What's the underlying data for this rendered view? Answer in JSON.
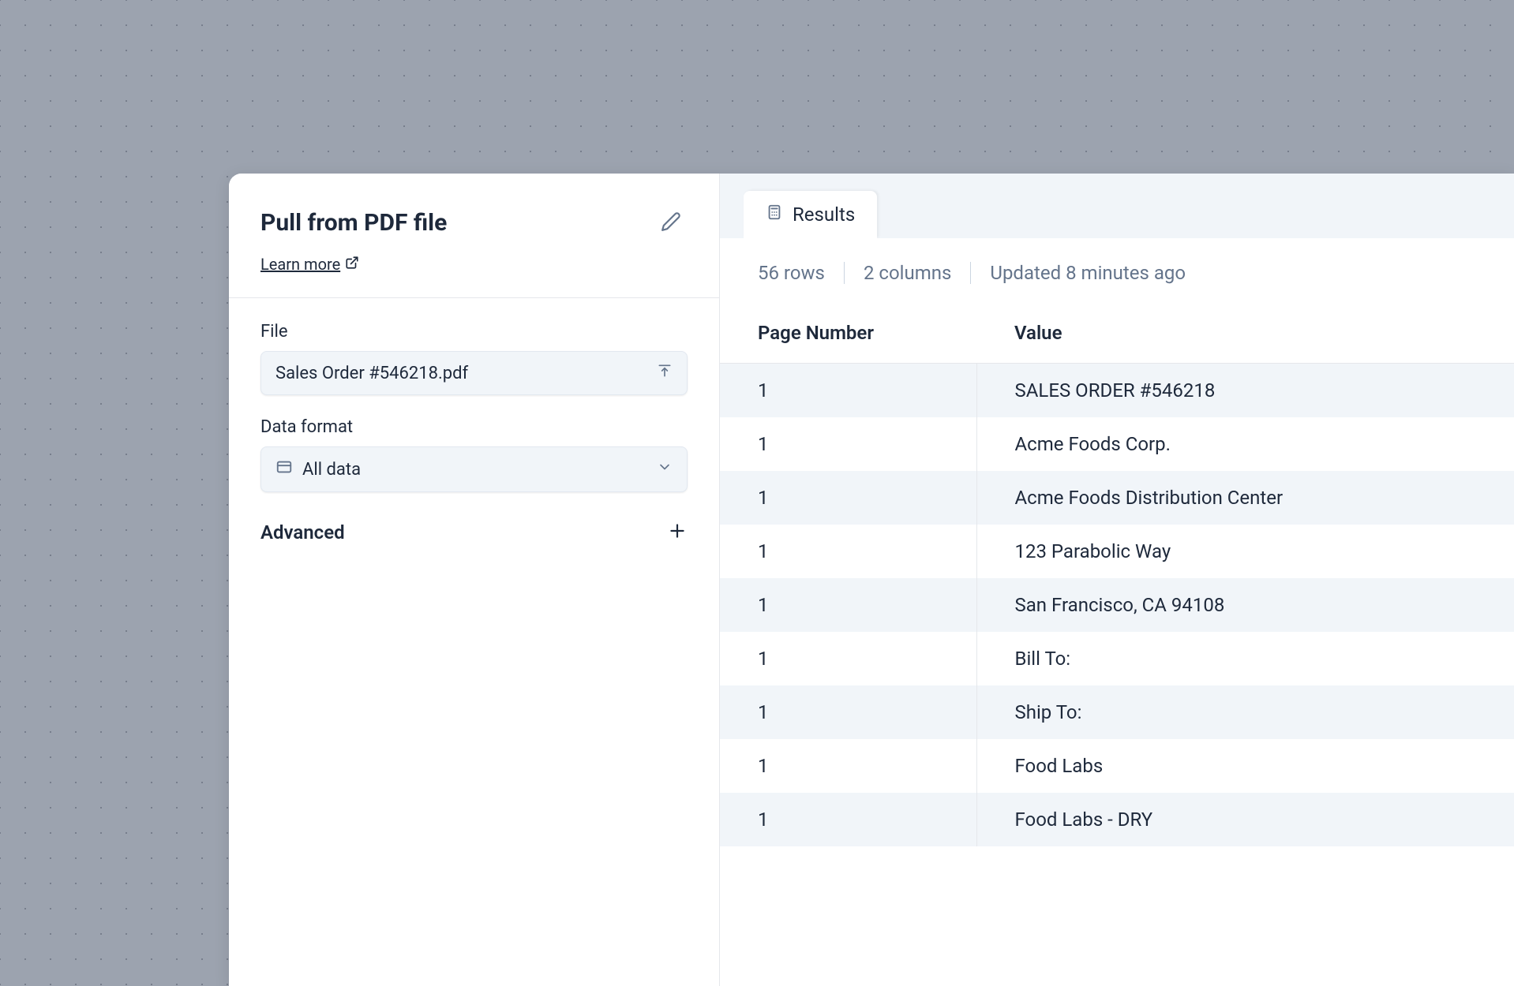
{
  "left_panel": {
    "title": "Pull from PDF file",
    "learn_more": "Learn more",
    "file": {
      "label": "File",
      "value": "Sales Order #546218.pdf"
    },
    "data_format": {
      "label": "Data format",
      "value": "All data"
    },
    "advanced_label": "Advanced"
  },
  "right_panel": {
    "tab_label": "Results",
    "status": {
      "rows": "56 rows",
      "columns": "2 columns",
      "updated": "Updated 8 minutes ago"
    },
    "table": {
      "columns": [
        "Page Number",
        "Value"
      ],
      "rows": [
        {
          "page": "1",
          "value": "SALES ORDER #546218"
        },
        {
          "page": "1",
          "value": "Acme Foods Corp."
        },
        {
          "page": "1",
          "value": "Acme Foods Distribution Center"
        },
        {
          "page": "1",
          "value": "123 Parabolic Way"
        },
        {
          "page": "1",
          "value": "San Francisco, CA 94108"
        },
        {
          "page": "1",
          "value": "Bill To:"
        },
        {
          "page": "1",
          "value": "Ship To:"
        },
        {
          "page": "1",
          "value": "Food Labs"
        },
        {
          "page": "1",
          "value": "Food Labs - DRY"
        }
      ]
    }
  }
}
